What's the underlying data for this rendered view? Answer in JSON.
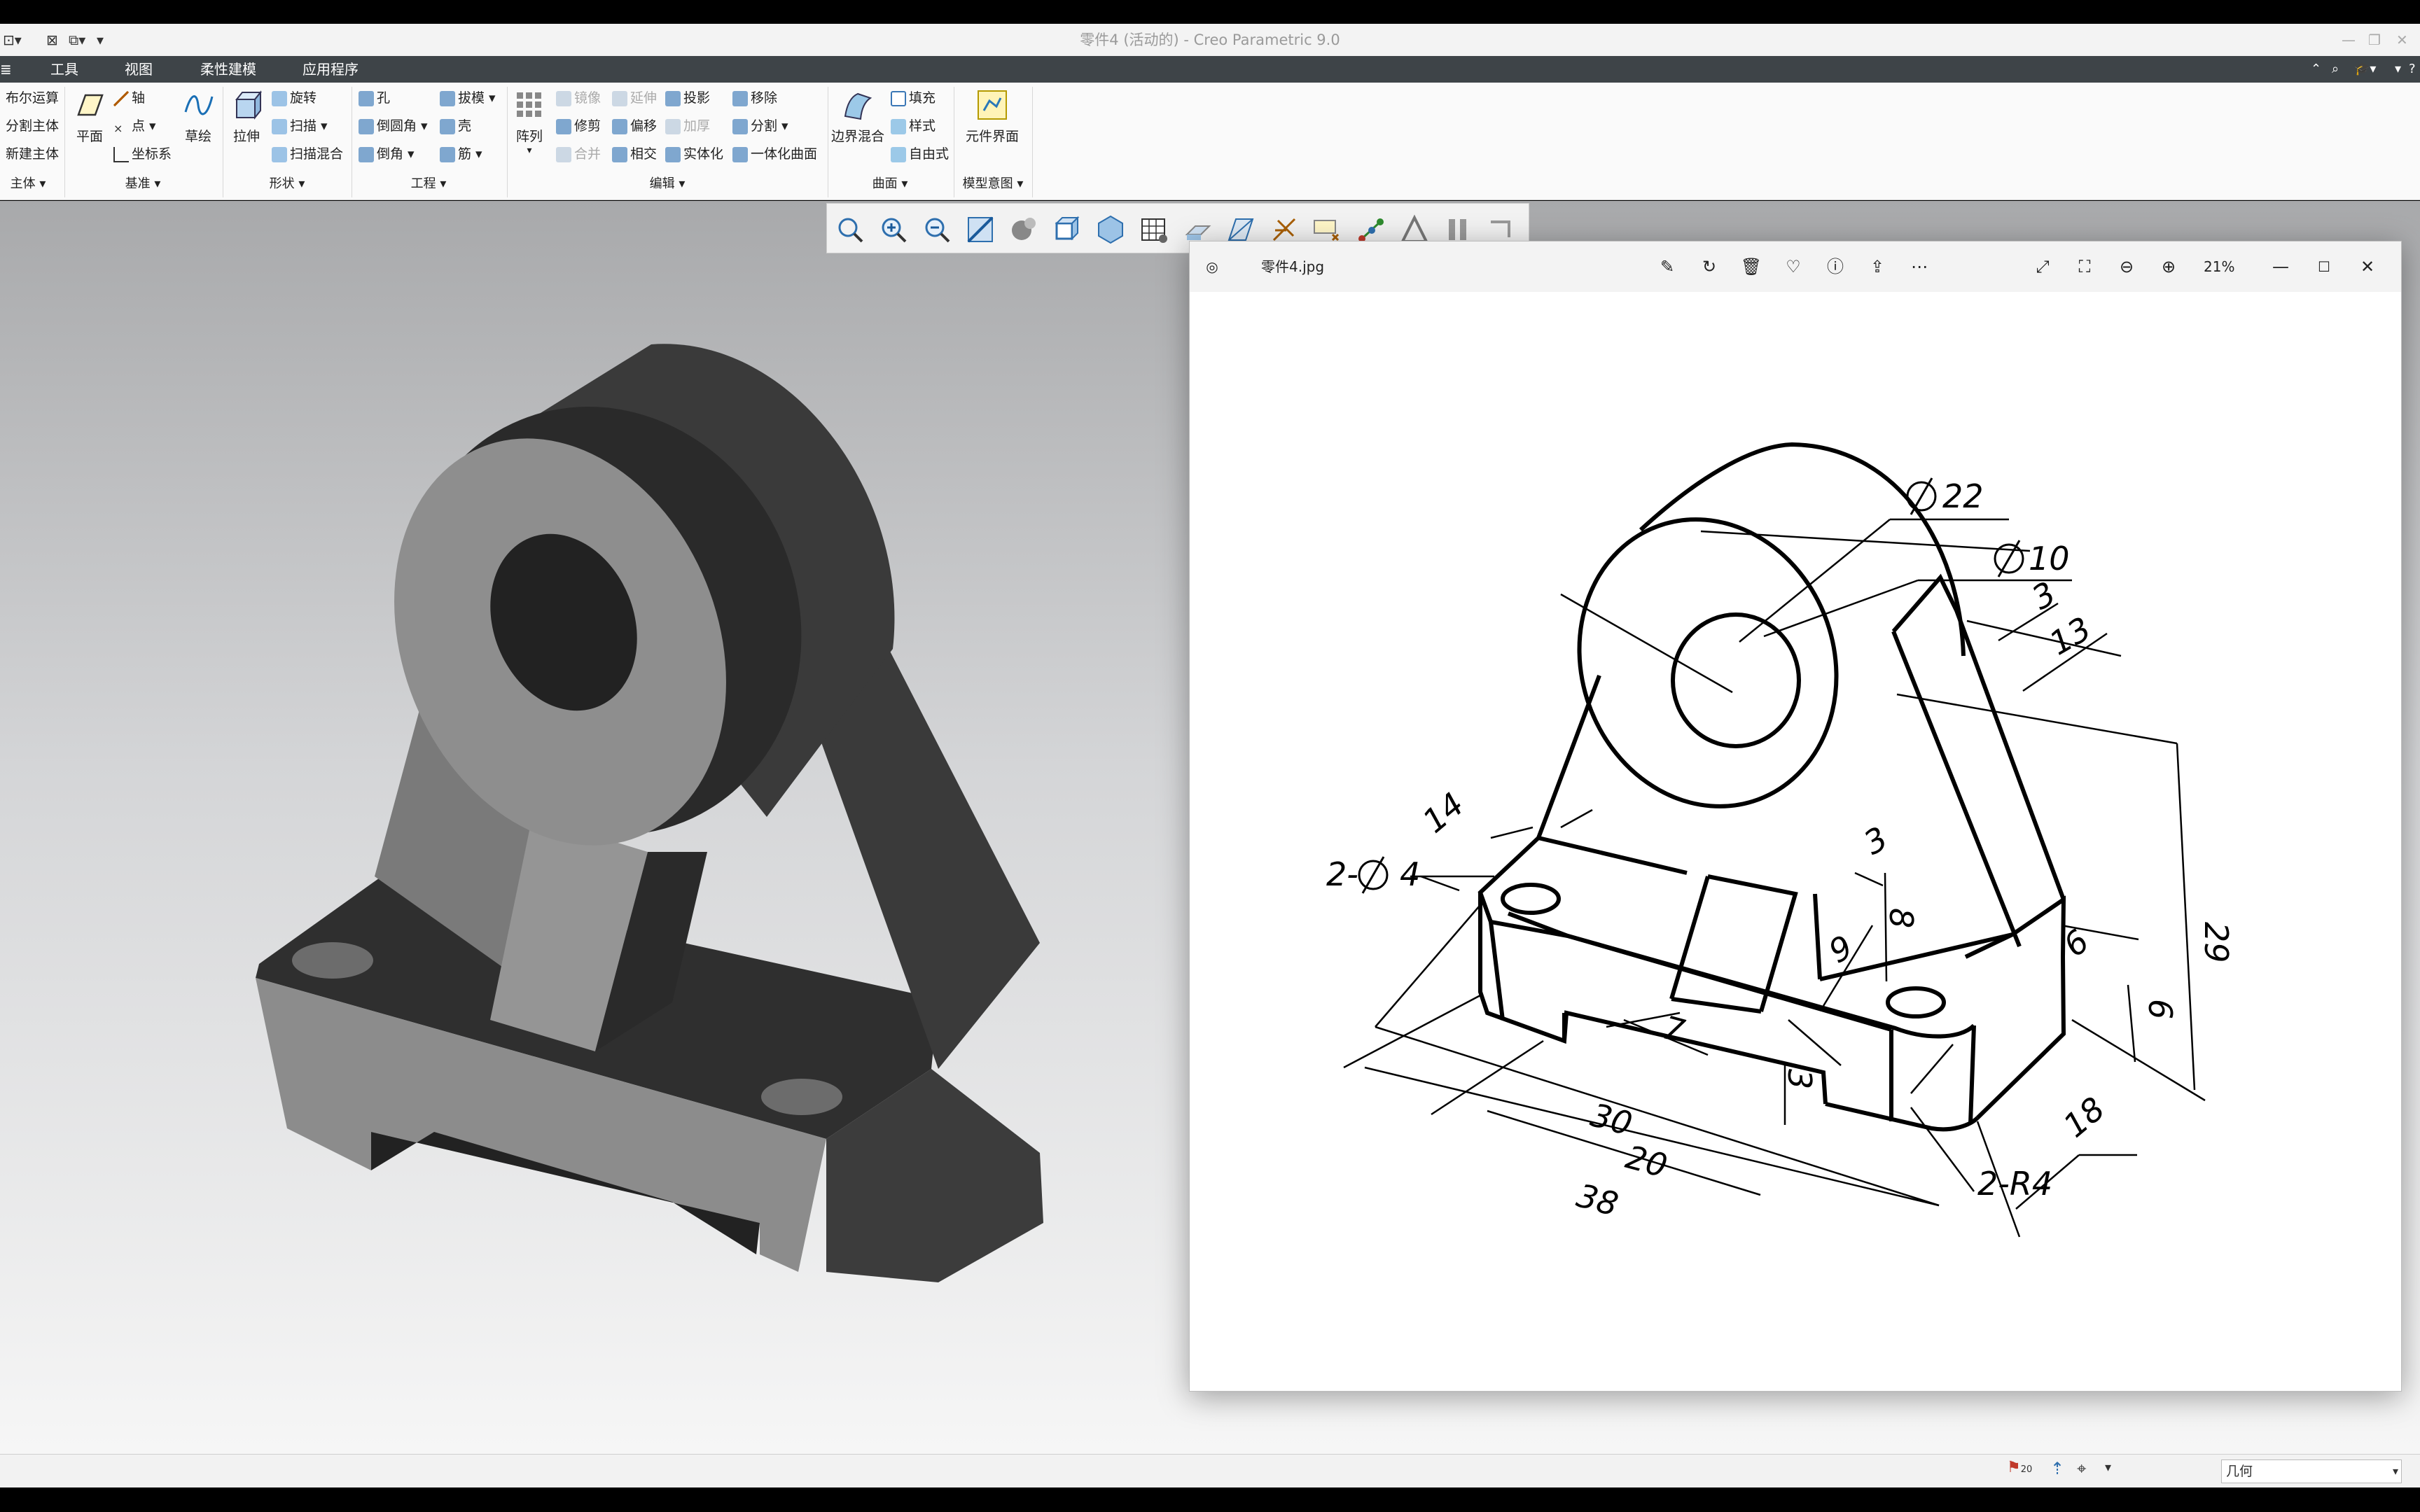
{
  "window": {
    "title": "零件4 (活动的) - Creo Parametric 9.0"
  },
  "menu": {
    "items": [
      "工具",
      "视图",
      "柔性建模",
      "应用程序"
    ]
  },
  "ribbon": {
    "col1": [
      "布尔运算",
      "分割主体",
      "新建主体"
    ],
    "datum_small": [
      "轴",
      "点",
      "坐标系"
    ],
    "plane": "平面",
    "sketch": "草绘",
    "extrude": "拉伸",
    "shape_small": [
      "旋转",
      "扫描",
      "扫描混合"
    ],
    "eng_col1": [
      "孔",
      "倒圆角",
      "倒角"
    ],
    "eng_col2": [
      "拔模",
      "壳",
      "筋"
    ],
    "pattern": "阵列",
    "edit_col1": [
      "镜像",
      "修剪",
      "合并"
    ],
    "edit_col2": [
      "延伸",
      "偏移",
      "相交"
    ],
    "edit_col3": [
      "投影",
      "加厚",
      "实体化"
    ],
    "edit_col4": [
      "移除",
      "分割",
      "一体化曲面"
    ],
    "boundary": "边界混合",
    "surf_small": [
      "填充",
      "样式",
      "自由式"
    ],
    "component_interface": "元件界面",
    "groups": {
      "body": "主体",
      "datum": "基准",
      "shape": "形状",
      "engineering": "工程",
      "editing": "编辑",
      "surfaces": "曲面",
      "model_intent": "模型意图"
    }
  },
  "viewer": {
    "filename": "零件4.jpg",
    "zoom": "21%",
    "drawing": {
      "dim_d22": "22",
      "dim_d10": "10",
      "dim_3a": "3",
      "dim_13": "13",
      "dim_14": "14",
      "dim_3b": "3",
      "dim_8": "8",
      "dim_9": "9",
      "dim_29": "29",
      "dim_6a": "6",
      "dim_6b": "6",
      "dim_7": "7",
      "dim_3c": "3",
      "dim_30": "30",
      "dim_20": "20",
      "dim_38": "38",
      "dim_18": "18",
      "dim_holes": "2-",
      "dim_holes_d": "4",
      "dim_r4": "2-R4"
    }
  },
  "status": {
    "flag_count": "20",
    "filter": "几何"
  },
  "colors": {
    "menubar": "#3e4448",
    "part_dark": "#3a3a3a",
    "part_light": "#8a8a8a"
  }
}
